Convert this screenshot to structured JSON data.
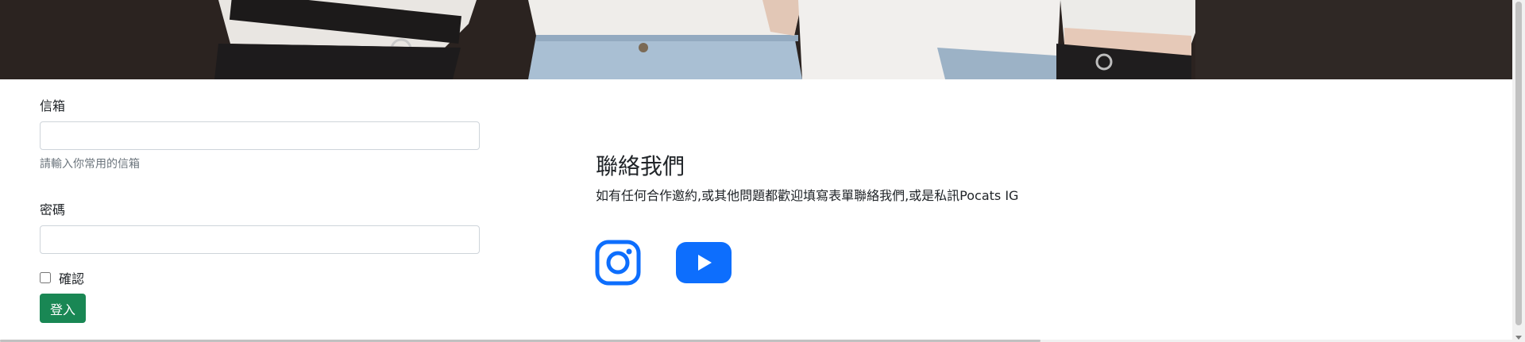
{
  "form": {
    "email_label": "信箱",
    "email_value": "",
    "email_help": "請輸入你常用的信箱",
    "password_label": "密碼",
    "password_value": "",
    "confirm_label": "確認",
    "confirm_checked": false,
    "submit_label": "登入"
  },
  "contact": {
    "title": "聯絡我們",
    "description": "如有任何合作邀約,或其他問題都歡迎填寫表單聯絡我們,或是私訊Pocats IG",
    "links": [
      {
        "icon": "instagram-icon"
      },
      {
        "icon": "youtube-icon"
      }
    ]
  },
  "colors": {
    "primary_blue": "#0d6efd",
    "submit_green": "#198754",
    "banner_dark": "#2b2320"
  }
}
